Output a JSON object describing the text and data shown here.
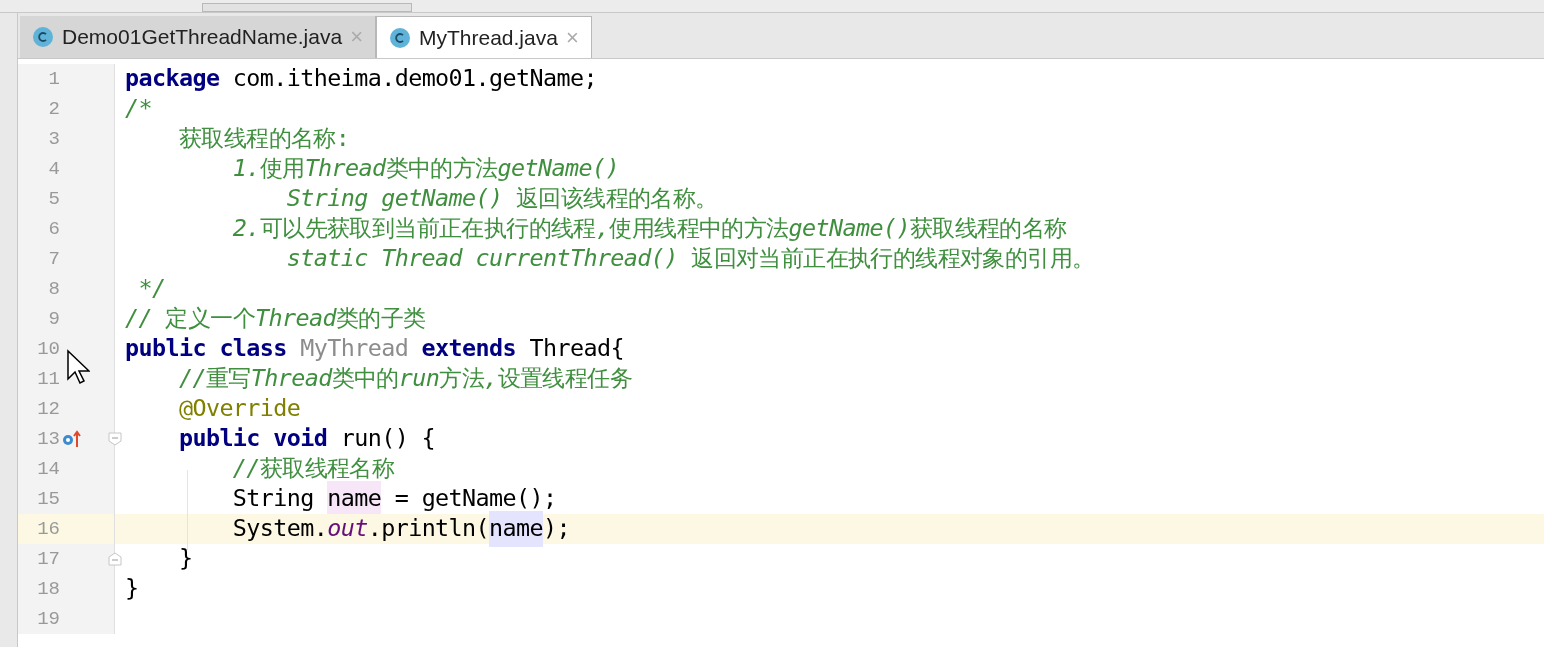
{
  "tabs": [
    {
      "label": "Demo01GetThreadName.java",
      "close": "×",
      "selected": false
    },
    {
      "label": "MyThread.java",
      "close": "×",
      "selected": true
    }
  ],
  "editor": {
    "lines": [
      {
        "number": "1",
        "current": false,
        "tokens": [
          {
            "text": "package",
            "kind": "keyword"
          },
          {
            "text": " com.itheima.demo01.getName;",
            "kind": "plain"
          }
        ]
      },
      {
        "number": "2",
        "current": false,
        "tokens": [
          {
            "text": "/*",
            "kind": "comment_italic"
          }
        ]
      },
      {
        "number": "3",
        "current": false,
        "tokens": [
          {
            "text": "    获取线程的名称:",
            "kind": "comment"
          }
        ]
      },
      {
        "number": "4",
        "current": false,
        "tokens": [
          {
            "text": "        1.",
            "kind": "comment_italic"
          },
          {
            "text": "使用",
            "kind": "comment"
          },
          {
            "text": "Thread",
            "kind": "comment_italic"
          },
          {
            "text": "类中的方法",
            "kind": "comment"
          },
          {
            "text": "getName()",
            "kind": "comment_italic"
          }
        ]
      },
      {
        "number": "5",
        "current": false,
        "tokens": [
          {
            "text": "            String getName() ",
            "kind": "comment_italic"
          },
          {
            "text": "返回该线程的名称。",
            "kind": "comment"
          }
        ]
      },
      {
        "number": "6",
        "current": false,
        "tokens": [
          {
            "text": "        2.",
            "kind": "comment_italic"
          },
          {
            "text": "可以先获取到当前正在执行的线程",
            "kind": "comment"
          },
          {
            "text": ",",
            "kind": "comment_italic"
          },
          {
            "text": "使用线程中的方法",
            "kind": "comment"
          },
          {
            "text": "getName()",
            "kind": "comment_italic"
          },
          {
            "text": "获取线程的名称",
            "kind": "comment"
          }
        ]
      },
      {
        "number": "7",
        "current": false,
        "tokens": [
          {
            "text": "            static Thread currentThread() ",
            "kind": "comment_italic"
          },
          {
            "text": "返回对当前正在执行的线程对象的引用。",
            "kind": "comment"
          }
        ]
      },
      {
        "number": "8",
        "current": false,
        "tokens": [
          {
            "text": " */",
            "kind": "comment_italic"
          }
        ]
      },
      {
        "number": "9",
        "current": false,
        "tokens": [
          {
            "text": "// ",
            "kind": "comment_italic"
          },
          {
            "text": "定义一个",
            "kind": "comment"
          },
          {
            "text": "Thread",
            "kind": "comment_italic"
          },
          {
            "text": "类的子类",
            "kind": "comment"
          }
        ]
      },
      {
        "number": "10",
        "current": false,
        "tokens": [
          {
            "text": "public class ",
            "kind": "keyword"
          },
          {
            "text": "MyThread",
            "kind": "unused"
          },
          {
            "text": " extends ",
            "kind": "keyword"
          },
          {
            "text": "Thread{",
            "kind": "plain"
          }
        ]
      },
      {
        "number": "11",
        "current": false,
        "tokens": [
          {
            "text": "    //",
            "kind": "comment_italic"
          },
          {
            "text": "重写",
            "kind": "comment"
          },
          {
            "text": "Thread",
            "kind": "comment_italic"
          },
          {
            "text": "类中的",
            "kind": "comment"
          },
          {
            "text": "run",
            "kind": "comment_italic"
          },
          {
            "text": "方法",
            "kind": "comment"
          },
          {
            "text": ",",
            "kind": "comment_italic"
          },
          {
            "text": "设置线程任务",
            "kind": "comment"
          }
        ]
      },
      {
        "number": "12",
        "current": false,
        "tokens": [
          {
            "text": "    @Override",
            "kind": "annotation"
          }
        ]
      },
      {
        "number": "13",
        "current": false,
        "override": true,
        "fold": true,
        "tokens": [
          {
            "text": "    public void ",
            "kind": "keyword"
          },
          {
            "text": "run() {",
            "kind": "plain"
          }
        ]
      },
      {
        "number": "14",
        "current": false,
        "tokens": [
          {
            "text": "        //",
            "kind": "comment_italic"
          },
          {
            "text": "获取线程名称",
            "kind": "comment"
          }
        ]
      },
      {
        "number": "15",
        "current": false,
        "tokens": [
          {
            "text": "        String ",
            "kind": "plain"
          },
          {
            "text": "name",
            "kind": "write"
          },
          {
            "text": " = getName();",
            "kind": "plain"
          }
        ]
      },
      {
        "number": "16",
        "current": true,
        "tokens": [
          {
            "text": "        System.",
            "kind": "plain"
          },
          {
            "text": "out",
            "kind": "static"
          },
          {
            "text": ".println(",
            "kind": "plain"
          },
          {
            "text": "name",
            "kind": "read"
          },
          {
            "text": ");",
            "kind": "plain"
          }
        ]
      },
      {
        "number": "17",
        "current": false,
        "override": false,
        "fold": true,
        "tokens": [
          {
            "text": "    }",
            "kind": "plain"
          }
        ]
      },
      {
        "number": "18",
        "current": false,
        "tokens": [
          {
            "text": "}",
            "kind": "plain"
          }
        ]
      },
      {
        "number": "19",
        "current": false
      }
    ]
  }
}
